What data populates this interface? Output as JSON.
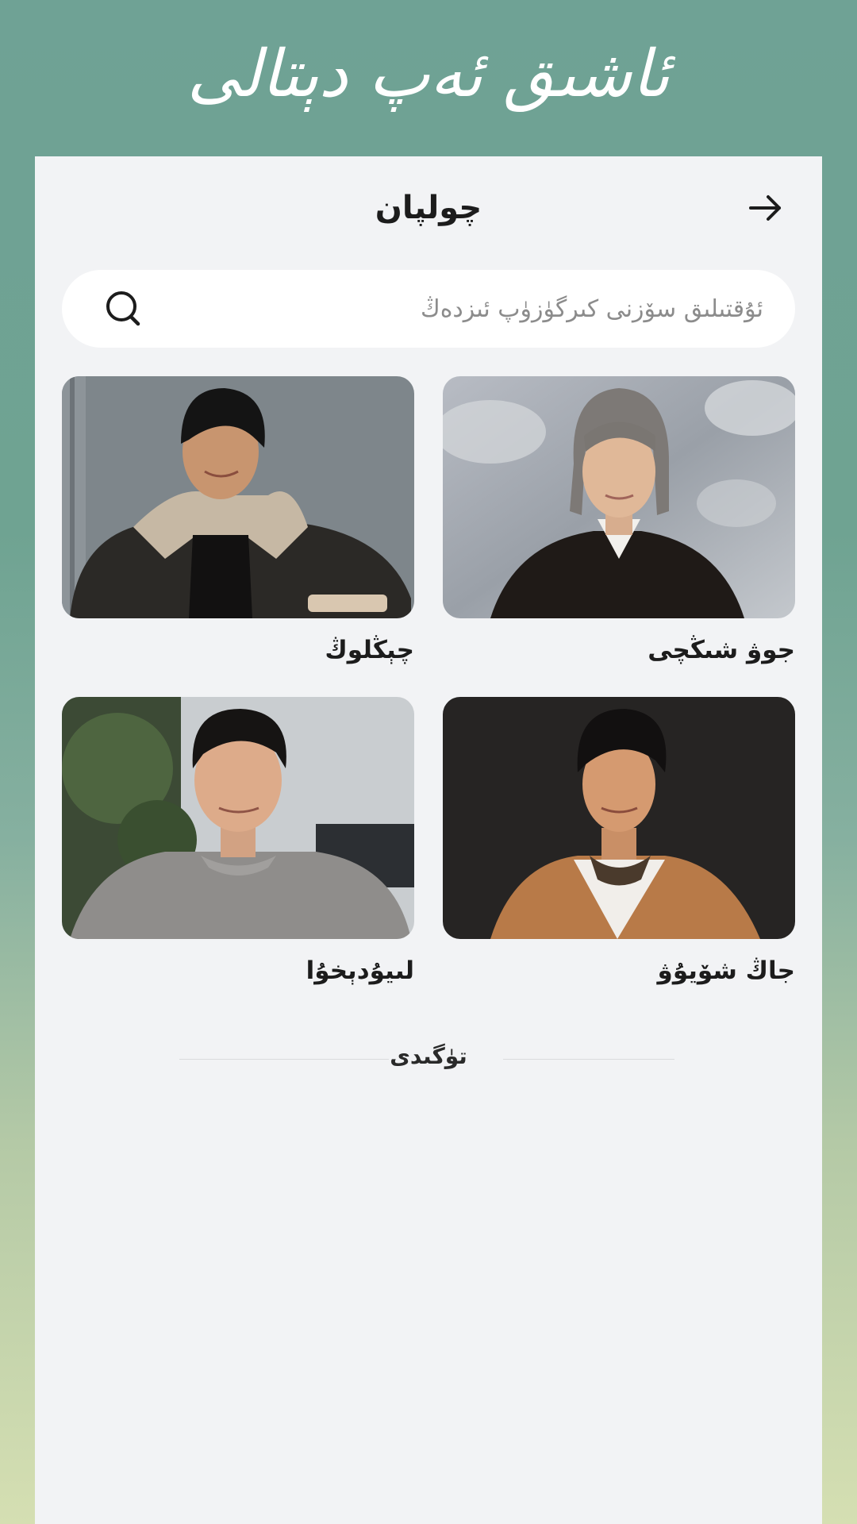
{
  "app": {
    "title": "ئاشىق ئەپ دېتالى"
  },
  "topbar": {
    "title": "چولپان",
    "back_icon": "arrow-right-icon"
  },
  "search": {
    "placeholder": "ئۇقتىلىق سۆزنى كىرگۈزۈپ ئىزدەڭ",
    "icon": "search-icon"
  },
  "grid": {
    "cards": [
      {
        "name": "جوۋ شىڭچى"
      },
      {
        "name": "چېڭلوڭ"
      },
      {
        "name": "جاڭ شۆيۇۋ"
      },
      {
        "name": "لىيۇدېخۇا"
      }
    ]
  },
  "footer": {
    "end_text": "تۈگىدى"
  },
  "colors": {
    "header_bg": "#6fa295",
    "panel_bg": "#f2f3f5",
    "text_dark": "#1c1c1c",
    "placeholder": "#8c8c8c"
  }
}
